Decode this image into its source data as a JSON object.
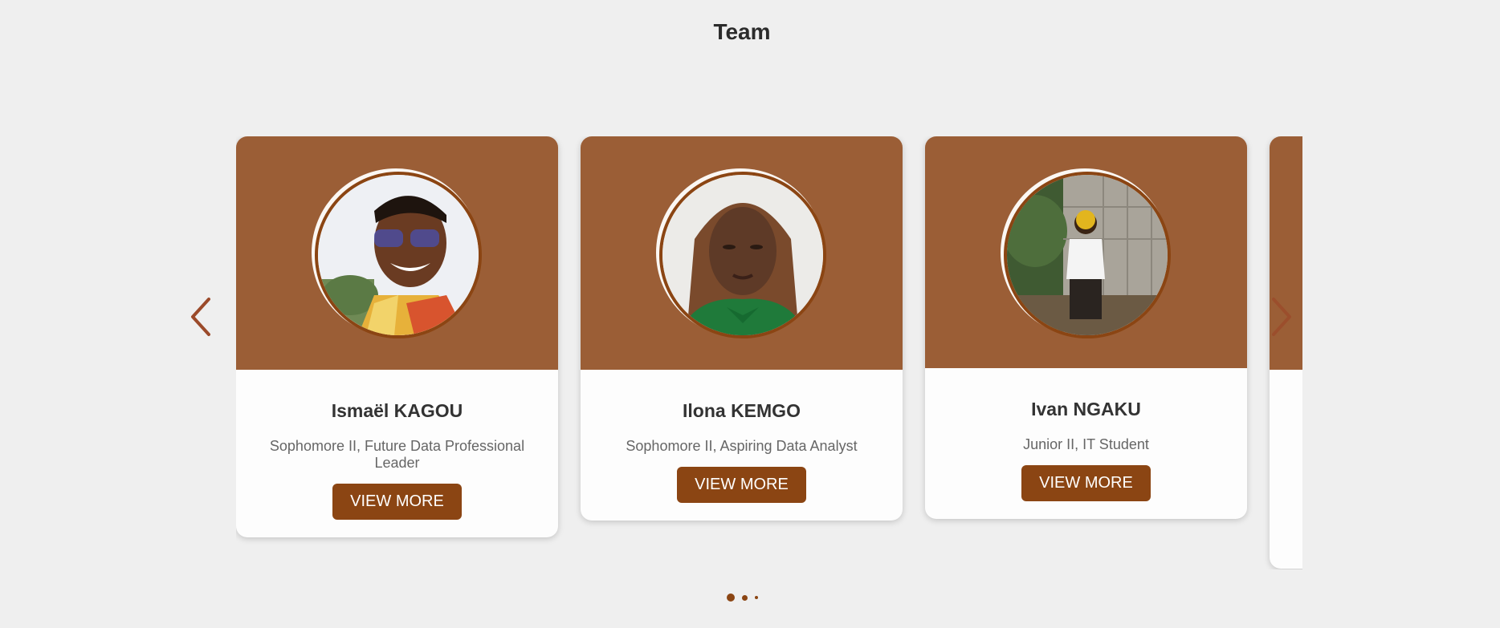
{
  "section": {
    "title": "Team"
  },
  "members": [
    {
      "name": "Ismaël KAGOU",
      "role": "Sophomore II, Future Data Professional Leader",
      "button": "VIEW MORE"
    },
    {
      "name": "Ilona KEMGO",
      "role": "Sophomore II, Aspiring Data Analyst",
      "button": "VIEW MORE"
    },
    {
      "name": "Ivan NGAKU",
      "role": "Junior II, IT Student",
      "button": "VIEW MORE"
    }
  ],
  "carousel": {
    "prev_icon": "chevron-left-icon",
    "next_icon": "chevron-right-icon",
    "dots": 3,
    "active_dot": 1
  },
  "colors": {
    "accent": "#8b4513",
    "card_header": "#9b5e36",
    "background": "#efefef"
  }
}
